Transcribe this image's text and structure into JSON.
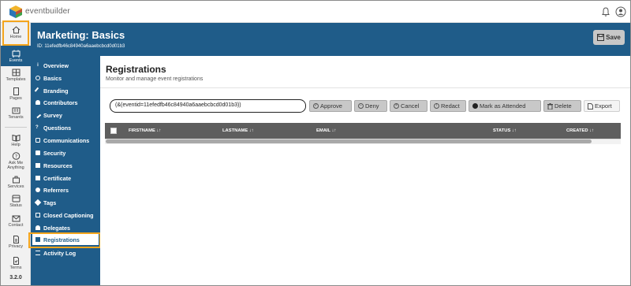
{
  "app": {
    "brand": "eventbuilder"
  },
  "rail": {
    "items": [
      {
        "label": "Home",
        "icon": "home-icon"
      },
      {
        "label": "Events",
        "icon": "events-icon"
      },
      {
        "label": "Templates",
        "icon": "templates-icon"
      },
      {
        "label": "Pages",
        "icon": "pages-icon"
      },
      {
        "label": "Tenants",
        "icon": "tenants-icon"
      },
      {
        "label": "Help",
        "icon": "help-icon"
      },
      {
        "label": "Ask Me Anything",
        "icon": "question-icon"
      },
      {
        "label": "Services",
        "icon": "services-icon"
      },
      {
        "label": "Status",
        "icon": "status-icon"
      },
      {
        "label": "Contact",
        "icon": "contact-icon"
      },
      {
        "label": "Privacy",
        "icon": "privacy-icon"
      },
      {
        "label": "Terms",
        "icon": "terms-icon"
      }
    ],
    "version": "3.2.0"
  },
  "header": {
    "title": "Marketing: Basics",
    "id_line": "ID: 11efedfb46c84940a6aaebcbcd0d01b3",
    "save_label": "Save"
  },
  "sidenav": {
    "items": [
      {
        "label": "Overview",
        "icon": "info-icon"
      },
      {
        "label": "Basics",
        "icon": "gear-icon"
      },
      {
        "label": "Branding",
        "icon": "brush-icon"
      },
      {
        "label": "Contributors",
        "icon": "people-icon"
      },
      {
        "label": "Survey",
        "icon": "edit-icon"
      },
      {
        "label": "Questions",
        "icon": "question-icon"
      },
      {
        "label": "Communications",
        "icon": "comm-icon"
      },
      {
        "label": "Security",
        "icon": "lock-icon"
      },
      {
        "label": "Resources",
        "icon": "folder-icon"
      },
      {
        "label": "Certificate",
        "icon": "certificate-icon"
      },
      {
        "label": "Referrers",
        "icon": "link-icon"
      },
      {
        "label": "Tags",
        "icon": "tag-icon"
      },
      {
        "label": "Closed Captioning",
        "icon": "cc-icon"
      },
      {
        "label": "Delegates",
        "icon": "delegates-icon"
      },
      {
        "label": "Registrations",
        "icon": "clipboard-icon"
      },
      {
        "label": "Activity Log",
        "icon": "list-icon"
      }
    ],
    "active": "Registrations"
  },
  "main": {
    "title": "Registrations",
    "description": "Monitor and manage event registrations",
    "filter_value": "(&(eventid=11efedfb46c84940a6aaebcbcd0d01b3))",
    "actions": {
      "approve": "Approve",
      "deny": "Deny",
      "cancel": "Cancel",
      "redact": "Redact",
      "mark_attended": "Mark as Attended",
      "delete": "Delete",
      "export": "Export"
    },
    "columns": [
      "FIRSTNAME",
      "LASTNAME",
      "EMAIL",
      "STATUS",
      "CREATED"
    ]
  }
}
